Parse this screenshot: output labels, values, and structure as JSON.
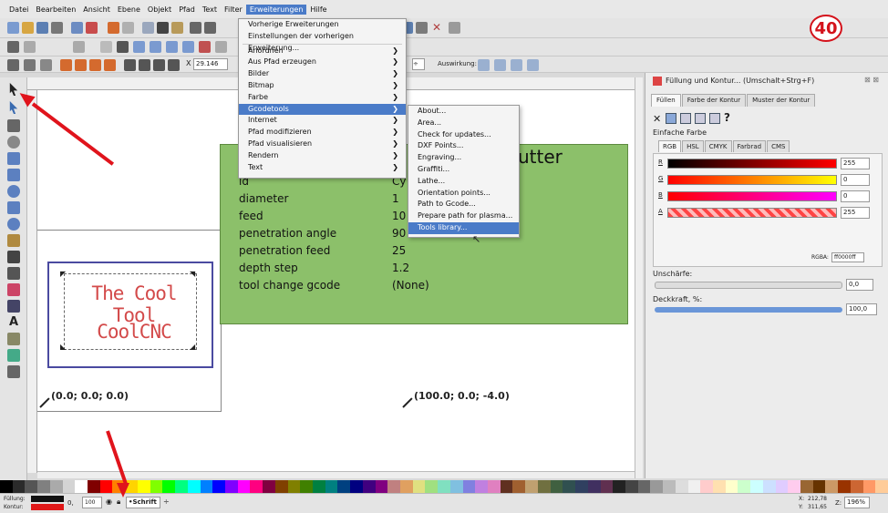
{
  "menubar": {
    "items": [
      "Datei",
      "Bearbeiten",
      "Ansicht",
      "Ebene",
      "Objekt",
      "Pfad",
      "Text",
      "Filter",
      "Erweiterungen",
      "Hilfe"
    ],
    "active": "Erweiterungen"
  },
  "toolbar": {
    "x_value": "29.146",
    "effect_label": "Auswirkung:"
  },
  "step_badge": "40",
  "ext_menu": {
    "items": [
      {
        "label": "Vorherige Erweiterungen",
        "submenu": false
      },
      {
        "label": "Einstellungen der vorherigen Erweiterung...",
        "submenu": false
      },
      {
        "label": "Anordnen",
        "submenu": true
      },
      {
        "label": "Aus Pfad erzeugen",
        "submenu": true
      },
      {
        "label": "Bilder",
        "submenu": true
      },
      {
        "label": "Bitmap",
        "submenu": true
      },
      {
        "label": "Farbe",
        "submenu": true
      },
      {
        "label": "Gcodetools",
        "submenu": true,
        "highlighted": true
      },
      {
        "label": "Internet",
        "submenu": true
      },
      {
        "label": "Pfad modifizieren",
        "submenu": true
      },
      {
        "label": "Pfad visualisieren",
        "submenu": true
      },
      {
        "label": "Rendern",
        "submenu": true
      },
      {
        "label": "Text",
        "submenu": true
      }
    ]
  },
  "gcode_menu": {
    "items": [
      "About...",
      "Area...",
      "Check for updates...",
      "DXF Points...",
      "Engraving...",
      "Graffiti...",
      "Lathe...",
      "Orientation points...",
      "Path to Gcode...",
      "Prepare path for plasma...",
      "Tools library..."
    ],
    "highlighted": "Tools library..."
  },
  "tool_box": {
    "title_fragment": "utter",
    "rows": [
      {
        "key": "id",
        "value": "Cy"
      },
      {
        "key": "diameter",
        "value": "1"
      },
      {
        "key": "feed",
        "value": "10"
      },
      {
        "key": "penetration angle",
        "value": "90"
      },
      {
        "key": "penetration feed",
        "value": "25"
      },
      {
        "key": "depth step",
        "value": "1.2"
      },
      {
        "key": "tool change gcode",
        "value": "(None)"
      }
    ]
  },
  "drawing": {
    "line1": "The Cool Tool",
    "line2": "CoolCNC",
    "origin_label": "(0.0; 0.0; 0.0)",
    "point_label": "(100.0; 0.0; -4.0)"
  },
  "panel": {
    "title": "Füllung und Kontur... (Umschalt+Strg+F)",
    "tabs": [
      "Füllen",
      "Farbe der Kontur",
      "Muster der Kontur"
    ],
    "fill_type": "Einfache Farbe",
    "color_tabs": [
      "RGB",
      "HSL",
      "CMYK",
      "Farbrad",
      "CMS"
    ],
    "channels": [
      {
        "name": "R",
        "value": "255"
      },
      {
        "name": "G",
        "value": "0"
      },
      {
        "name": "B",
        "value": "0"
      },
      {
        "name": "A",
        "value": "255"
      }
    ],
    "rgba_label": "RGBA:",
    "rgba_value": "ff0000ff",
    "blur_label": "Unschärfe:",
    "blur_value": "0,0",
    "opacity_label": "Deckkraft, %:",
    "opacity_value": "100,0"
  },
  "status": {
    "fill_label": "Füllung:",
    "stroke_label": "Kontur:",
    "stroke_width": "0,",
    "opacity": "100",
    "layer": "•Schrift",
    "x_label": "X:",
    "x_value": "212,78",
    "y_label": "Y:",
    "y_value": "311,65",
    "zoom_label": "Z:",
    "zoom_value": "196%"
  },
  "colors": {
    "accent": "#4a7bc8",
    "tool_box_fill": "#8cc06a",
    "text_red": "#d34a4a",
    "badge": "#d4121b"
  },
  "palette": [
    "#000000",
    "#2b2b2b",
    "#555",
    "#808080",
    "#aaa",
    "#d4d4d4",
    "#fff",
    "#800000",
    "#ff0000",
    "#ff8000",
    "#ffd400",
    "#ffff00",
    "#80ff00",
    "#00ff00",
    "#00ff80",
    "#00ffff",
    "#0080ff",
    "#0000ff",
    "#8000ff",
    "#ff00ff",
    "#ff0080",
    "#800040",
    "#804000",
    "#808000",
    "#408000",
    "#008040",
    "#008080",
    "#004080",
    "#000080",
    "#400080",
    "#800080",
    "#c08080",
    "#e0a060",
    "#e0e080",
    "#a0e080",
    "#80e0c0",
    "#80c0e0",
    "#8080e0",
    "#c080e0",
    "#e080c0",
    "#603020",
    "#a06030",
    "#c0a070",
    "#707040",
    "#406040",
    "#305050",
    "#304060",
    "#403060",
    "#603050",
    "#222",
    "#444",
    "#666",
    "#999",
    "#bbb",
    "#ddd",
    "#f0f0f0",
    "#ffcccc",
    "#ffe0b0",
    "#ffffcc",
    "#ccffcc",
    "#ccffff",
    "#cce0ff",
    "#e0ccff",
    "#ffccee",
    "#996633",
    "#663300",
    "#cc9966",
    "#993300",
    "#cc6633",
    "#ff9966",
    "#ffcc99"
  ]
}
